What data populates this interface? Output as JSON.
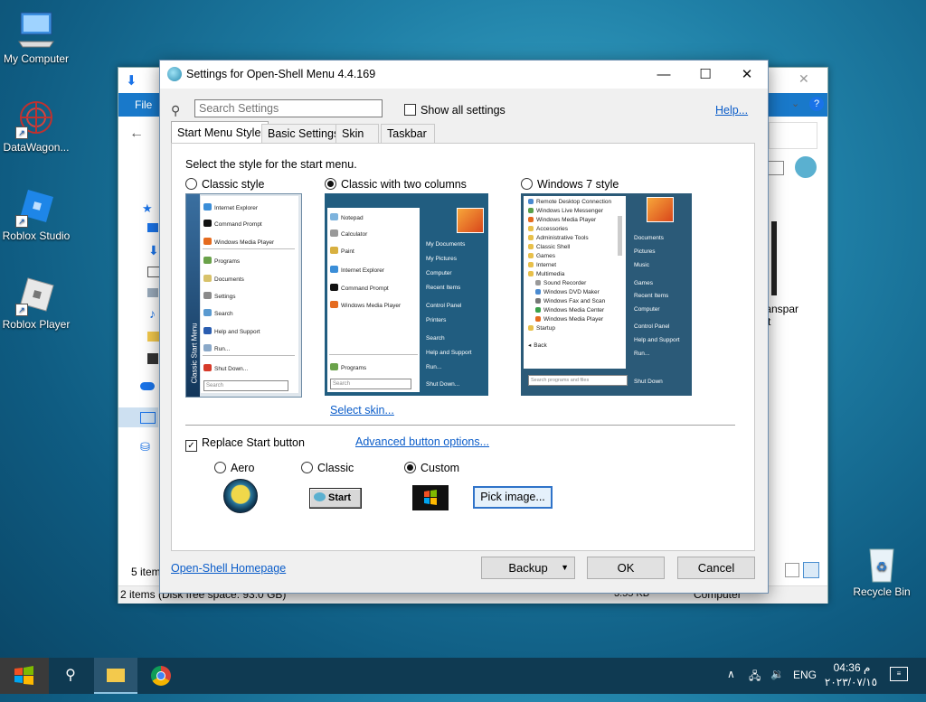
{
  "desktop": {
    "icons": [
      {
        "label": "My Computer"
      },
      {
        "label": "DataWagon..."
      },
      {
        "label": "Roblox Studio"
      },
      {
        "label": "Roblox Player"
      },
      {
        "label": "Recycle Bin"
      }
    ]
  },
  "explorer": {
    "menu_file": "File",
    "item_count": "5 item",
    "status_items": "2 items (Disk free space: 93.0 GB)",
    "status_size": "3.55 KB",
    "status_location": "Computer",
    "side_text_1": "transpar",
    "side_text_2": "t"
  },
  "dialog": {
    "title": "Settings for Open-Shell Menu 4.4.169",
    "search": {
      "placeholder": "Search Settings"
    },
    "show_all": "Show all settings",
    "help": "Help...",
    "tabs": [
      "Start Menu Style",
      "Basic Settings",
      "Skin",
      "Taskbar"
    ],
    "prompt": "Select the style for the start menu.",
    "styles": [
      {
        "label": "Classic style",
        "selected": false
      },
      {
        "label": "Classic with two columns",
        "selected": true
      },
      {
        "label": "Windows 7 style",
        "selected": false
      }
    ],
    "select_skin": "Select skin...",
    "replace_start": "Replace Start button",
    "advanced_options": "Advanced button options...",
    "button_styles": [
      {
        "label": "Aero",
        "selected": false
      },
      {
        "label": "Classic",
        "selected": false
      },
      {
        "label": "Custom",
        "selected": true
      }
    ],
    "classic_button_text": "Start",
    "pick_image": "Pick image...",
    "homepage": "Open-Shell Homepage",
    "backup": "Backup",
    "ok": "OK",
    "cancel": "Cancel"
  },
  "preview_classic": {
    "items": [
      "Internet Explorer",
      "Command Prompt",
      "Windows Media Player",
      "Programs",
      "Documents",
      "Settings",
      "Search",
      "Help and Support",
      "Run...",
      "Shut Down..."
    ],
    "side_label": "Classic Start Menu",
    "search": "Search"
  },
  "preview_two_col": {
    "left_items": [
      "Notepad",
      "Calculator",
      "Paint",
      "Internet Explorer",
      "Command Prompt",
      "Windows Media Player"
    ],
    "programs": "Programs",
    "right_items": [
      "My Documents",
      "My Pictures",
      "Computer",
      "Recent Items",
      "Control Panel",
      "Printers",
      "Search",
      "Help and Support",
      "Run..."
    ],
    "shutdown": "Shut Down...",
    "search": "Search"
  },
  "preview_win7": {
    "left_items": [
      "Remote Desktop Connection",
      "Windows Live Messenger",
      "Windows Media Player",
      "Accessories",
      "Administrative Tools",
      "Classic Shell",
      "Games",
      "Internet",
      "Multimedia",
      "Sound Recorder",
      "Windows DVD Maker",
      "Windows Fax and Scan",
      "Windows Media Center",
      "Windows Media Player",
      "Startup",
      "Back"
    ],
    "right_items": [
      "Documents",
      "Pictures",
      "Music",
      "Games",
      "Recent Items",
      "Computer",
      "Control Panel",
      "Help and Support",
      "Run..."
    ],
    "shutdown": "Shut Down",
    "search": "Search programs and files"
  },
  "taskbar": {
    "language": "ENG",
    "time": "04:36 م",
    "date": "٢٠٢٣/٠٧/١٥"
  }
}
